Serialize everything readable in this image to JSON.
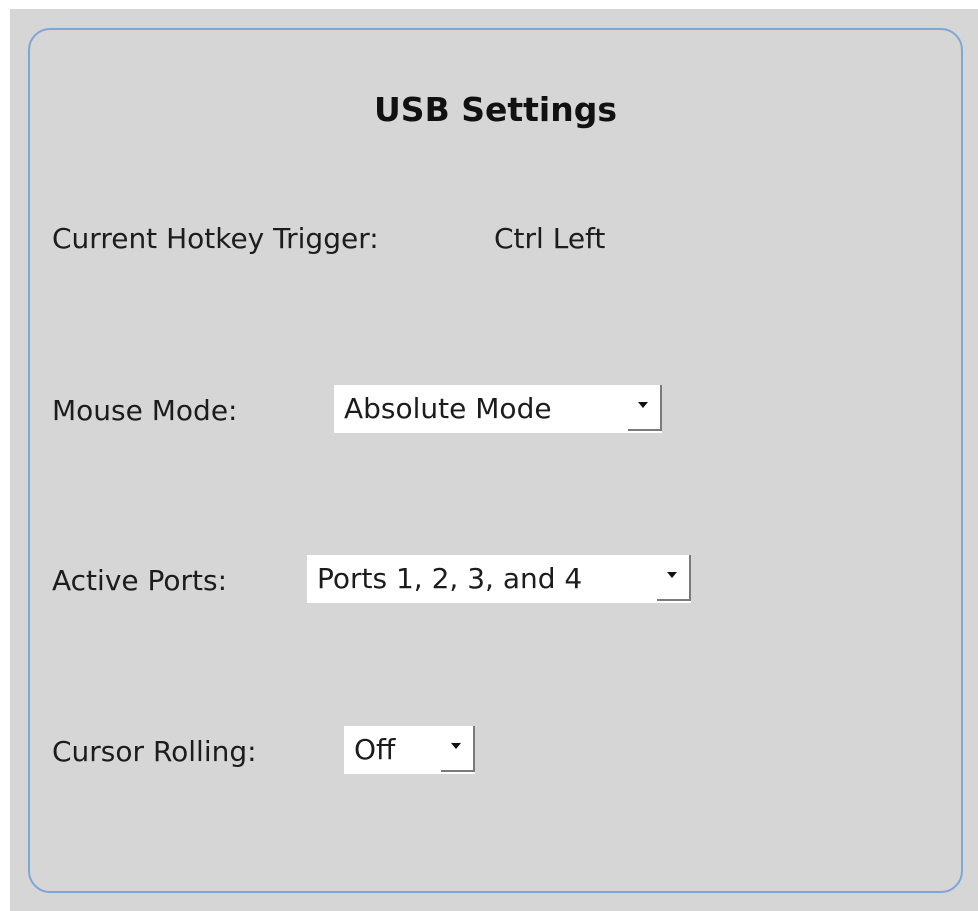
{
  "panel": {
    "title": "USB Settings"
  },
  "hotkey": {
    "label": "Current Hotkey Trigger:",
    "value": "Ctrl Left"
  },
  "mouse_mode": {
    "label": "Mouse Mode:",
    "selected": "Absolute Mode"
  },
  "active_ports": {
    "label": "Active Ports:",
    "selected": "Ports 1, 2, 3, and 4"
  },
  "cursor_rolling": {
    "label": "Cursor Rolling:",
    "selected": "Off"
  },
  "colors": {
    "panel_bg": "#d6d6d6",
    "panel_border": "#7fa6d6",
    "select_bg": "#ffffff"
  },
  "icons": {
    "dropdown": "chevron-down-icon"
  }
}
